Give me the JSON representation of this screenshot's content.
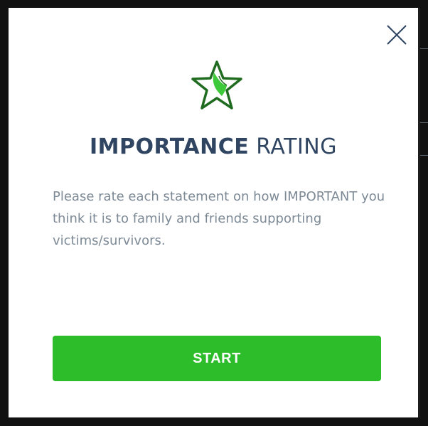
{
  "modal": {
    "title_bold": "IMPORTANCE",
    "title_light": "RATING",
    "description": "Please rate each statement on how IMPORTANT you think it is to family and friends supporting victims/survivors.",
    "start_label": "START"
  },
  "icons": {
    "close": "close-icon",
    "star": "star-icon"
  },
  "colors": {
    "primary_green": "#2ebd2a",
    "title_navy": "#2f4562",
    "text_gray": "#7d8a96",
    "star_dark_green": "#1f6b1f"
  }
}
